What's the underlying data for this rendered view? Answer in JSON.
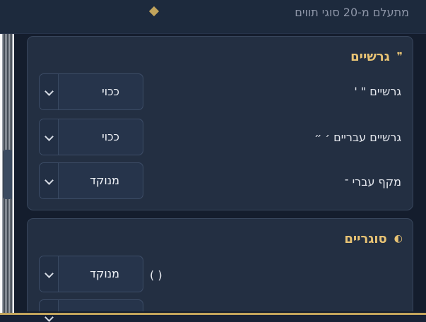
{
  "header": {
    "title": "מתעלם מ-20 סוגי תווים"
  },
  "cards": [
    {
      "title": "גרשיים",
      "icon": "quote-icon",
      "icon_glyph": "❞",
      "rows": [
        {
          "label": "גרשיים \" '",
          "value": "ככוי"
        },
        {
          "label": "גרשיים עבריים ׳ ״",
          "value": "ככוי"
        },
        {
          "label": "מקף עברי ־",
          "value": "מנוקד"
        }
      ]
    },
    {
      "title": "סוגריים",
      "icon": "half-circle-icon",
      "icon_glyph": "◐",
      "rows": [
        {
          "label": "( )",
          "value": "מנוקד"
        }
      ]
    }
  ],
  "colors": {
    "accent": "#e8c374",
    "background": "#182236",
    "card": "#232f42"
  }
}
